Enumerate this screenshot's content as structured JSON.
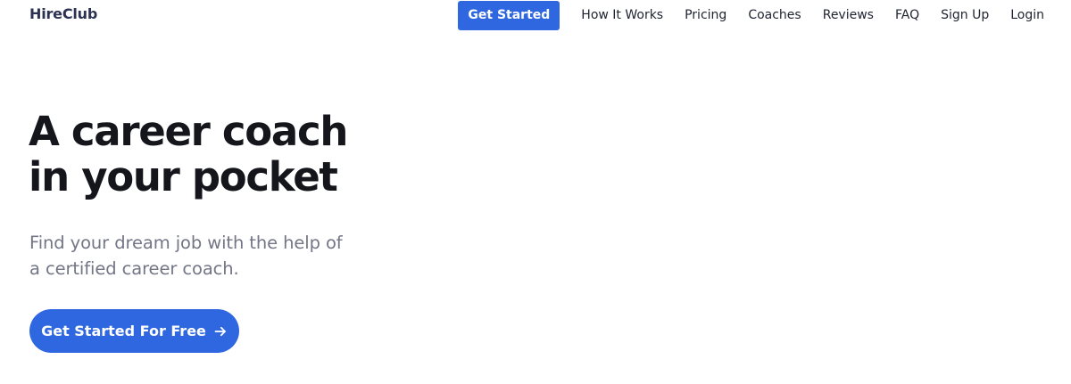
{
  "brand": {
    "name": "HireClub"
  },
  "nav": {
    "cta_label": "Get Started",
    "links": [
      "How It Works",
      "Pricing",
      "Coaches",
      "Reviews",
      "FAQ",
      "Sign Up",
      "Login"
    ]
  },
  "hero": {
    "title_lines": [
      "A career coach",
      "in your pocket"
    ],
    "subtitle_lines": [
      "Find your dream job with the help of",
      "a certified career coach."
    ],
    "cta_label": "Get Started For Free",
    "cta_icon": "arrow-right-icon"
  },
  "colors": {
    "accent": "#2f67e0",
    "heading": "#15161c",
    "muted": "#737686",
    "logo": "#2c3352",
    "background": "#ffffff"
  }
}
